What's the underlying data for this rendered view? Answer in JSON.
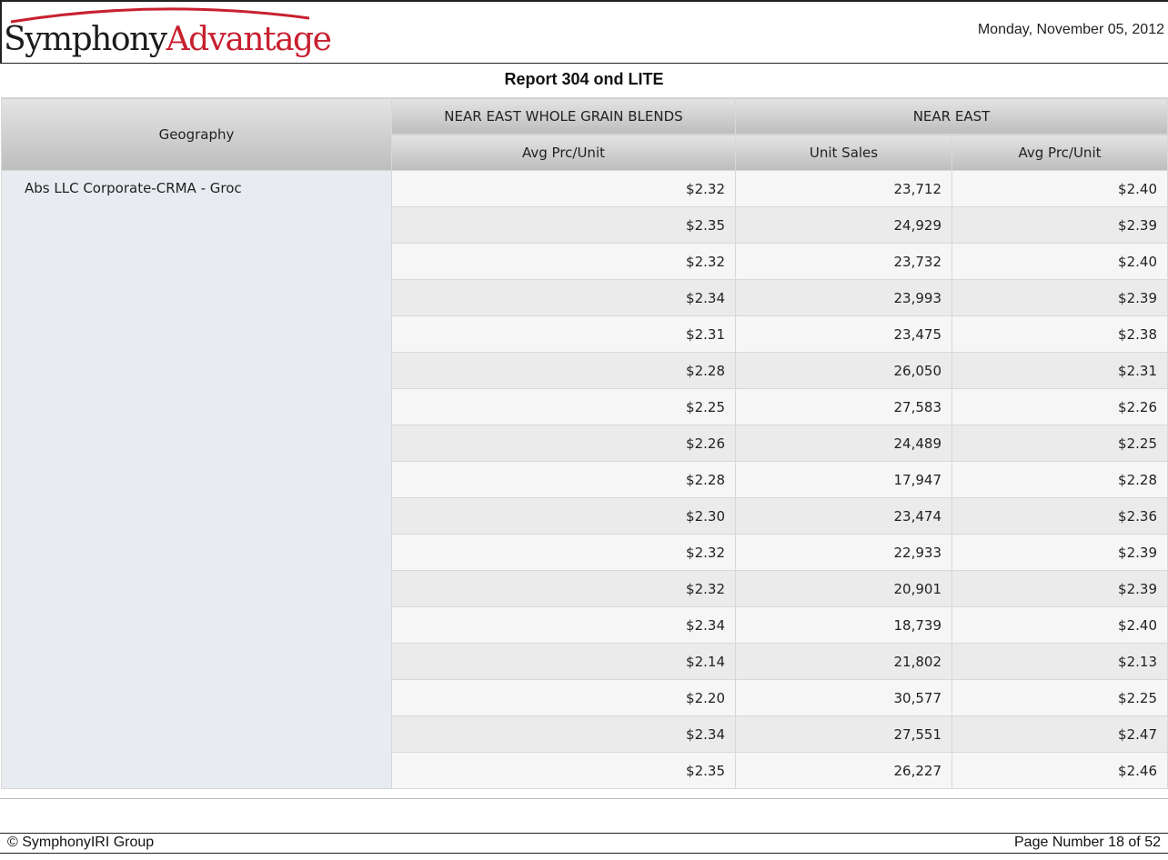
{
  "header": {
    "logo_part1": "Symphony",
    "logo_part2": "Advantage",
    "date": "Monday, November 05, 2012",
    "brand_red": "#c8202f"
  },
  "report": {
    "title": "Report 304 ond LITE"
  },
  "table": {
    "geography_header": "Geography",
    "group1_header": "NEAR EAST WHOLE GRAIN BLENDS",
    "group2_header": "NEAR EAST",
    "col1_header": "Avg Prc/Unit",
    "col2_header": "Unit Sales",
    "col3_header": "Avg Prc/Unit",
    "geography": "Abs LLC Corporate-CRMA - Groc",
    "rows": [
      [
        "$2.32",
        "23,712",
        "$2.40"
      ],
      [
        "$2.35",
        "24,929",
        "$2.39"
      ],
      [
        "$2.32",
        "23,732",
        "$2.40"
      ],
      [
        "$2.34",
        "23,993",
        "$2.39"
      ],
      [
        "$2.31",
        "23,475",
        "$2.38"
      ],
      [
        "$2.28",
        "26,050",
        "$2.31"
      ],
      [
        "$2.25",
        "27,583",
        "$2.26"
      ],
      [
        "$2.26",
        "24,489",
        "$2.25"
      ],
      [
        "$2.28",
        "17,947",
        "$2.28"
      ],
      [
        "$2.30",
        "23,474",
        "$2.36"
      ],
      [
        "$2.32",
        "22,933",
        "$2.39"
      ],
      [
        "$2.32",
        "20,901",
        "$2.39"
      ],
      [
        "$2.34",
        "18,739",
        "$2.40"
      ],
      [
        "$2.14",
        "21,802",
        "$2.13"
      ],
      [
        "$2.20",
        "30,577",
        "$2.25"
      ],
      [
        "$2.34",
        "27,551",
        "$2.47"
      ],
      [
        "$2.35",
        "26,227",
        "$2.46"
      ]
    ]
  },
  "footer": {
    "copyright": "© SymphonyIRI Group",
    "page_number": "Page Number 18 of 52"
  }
}
